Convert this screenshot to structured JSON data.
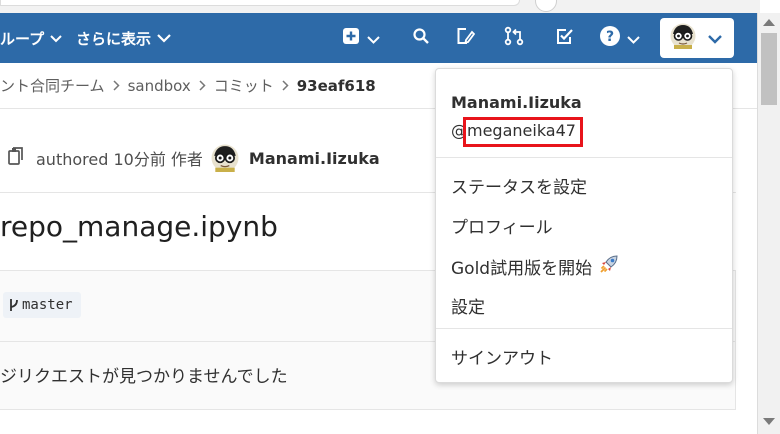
{
  "nav": {
    "groups_label": "ループ",
    "more_label": "さらに表示"
  },
  "breadcrumb": {
    "group": "ント合同チーム",
    "project": "sandbox",
    "commits": "コミット",
    "sha": "93eaf618"
  },
  "commit": {
    "authored_text": "authored 10分前 作者",
    "author": "Manami.Iizuka"
  },
  "file": {
    "title": "repo_manage.ipynb"
  },
  "branch": {
    "name": "master"
  },
  "merge_request": {
    "empty_text": "ジリクエストが見つかりませんでした"
  },
  "user_menu": {
    "name": "Manami.Iizuka",
    "handle": "@meganeika47",
    "items": {
      "status": "ステータスを設定",
      "profile": "プロフィール",
      "gold_trial": "Gold試用版を開始",
      "settings": "設定",
      "sign_out": "サインアウト"
    }
  },
  "colors": {
    "navbar": "#2d6aa8",
    "highlight_box": "#e8141b"
  }
}
